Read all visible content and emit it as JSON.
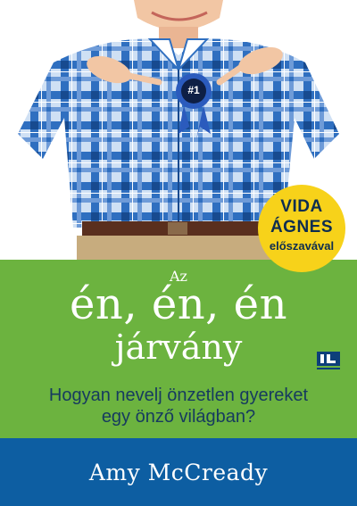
{
  "cover": {
    "title_small": "Az",
    "title_line1": "én, én, én",
    "title_line2": "járvány",
    "subtitle_line1": "Hogyan nevelj önzetlen gyereket",
    "subtitle_line2": "egy önző világban?",
    "author": "Amy McCready",
    "colors": {
      "green": "#6cb33f",
      "blue": "#0d5ea2",
      "yellow": "#f7d21a",
      "shirt_blue": "#2f6fc0"
    }
  },
  "badge": {
    "line1": "VIDA",
    "line2": "ÁGNES",
    "line3": "előszavával"
  },
  "photo": {
    "rosette_text": "#1",
    "icon": "boy-pointing-at-rosette"
  },
  "publisher": {
    "icon": "publisher-logo-icon"
  }
}
